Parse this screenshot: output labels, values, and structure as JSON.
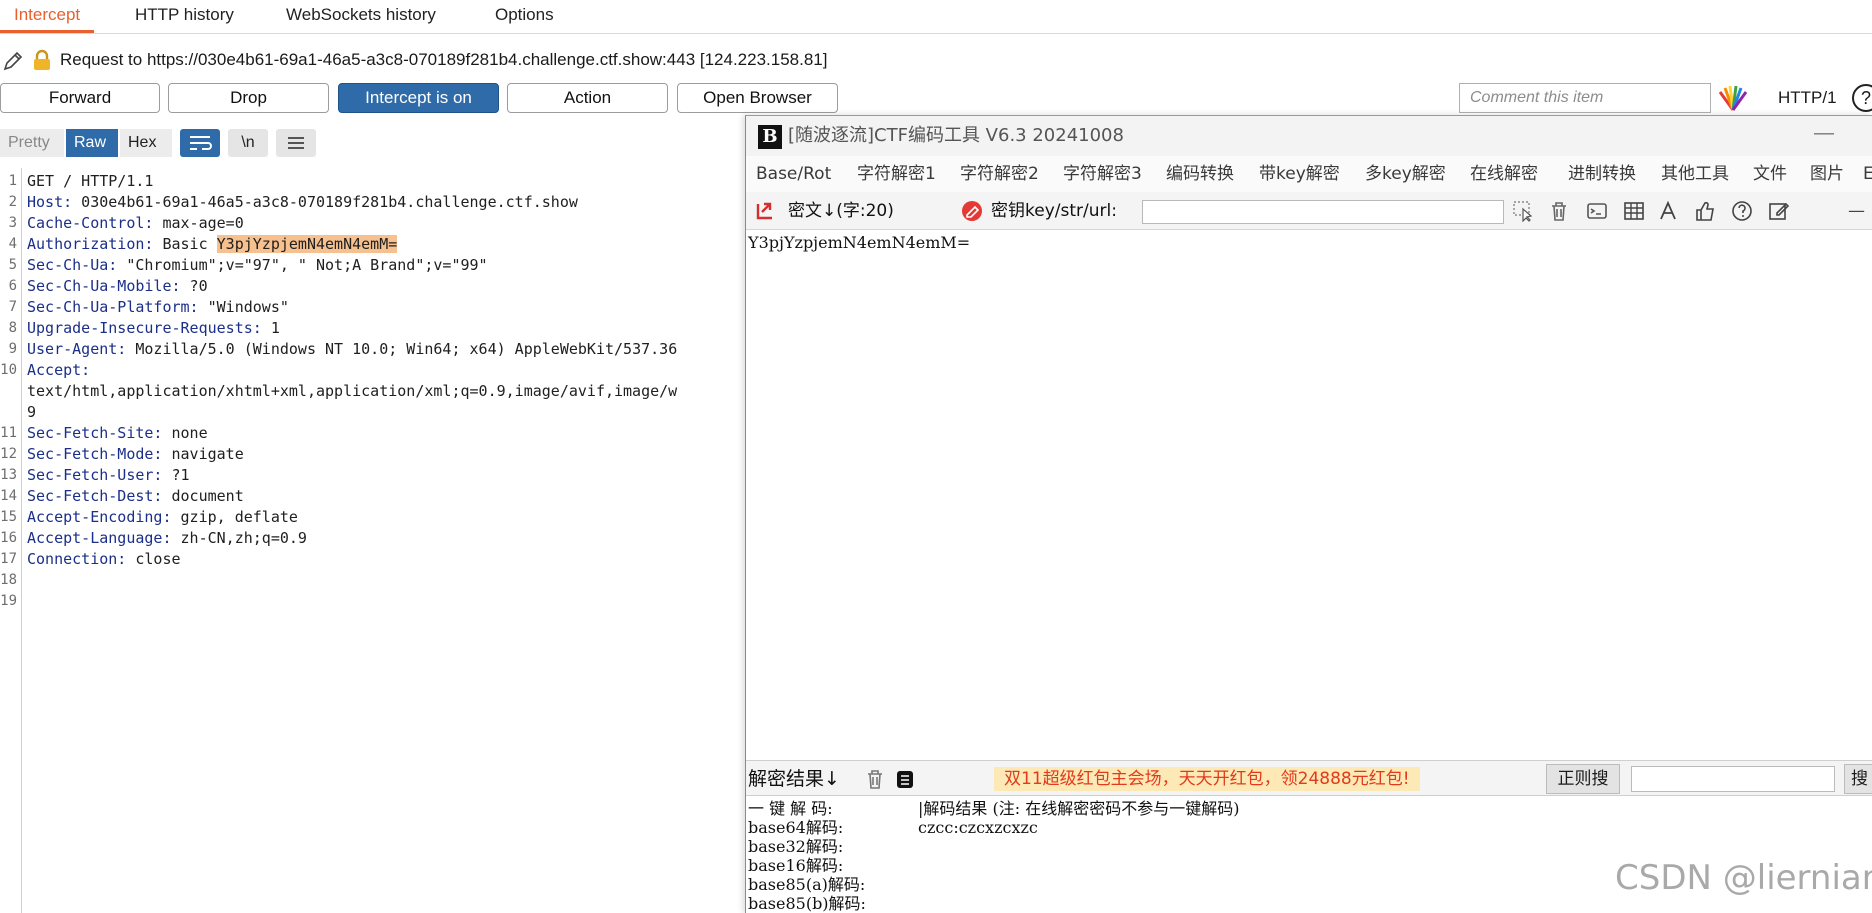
{
  "tabs": [
    "Intercept",
    "HTTP history",
    "WebSockets history",
    "Options"
  ],
  "request_line": "Request to https://030e4b61-69a1-46a5-a3c8-070189f281b4.challenge.ctf.show:443  [124.223.158.81]",
  "toolbar": {
    "forward": "Forward",
    "drop": "Drop",
    "intercept": "Intercept is on",
    "action": "Action",
    "open_browser": "Open Browser",
    "comment_placeholder": "Comment this item",
    "http_version": "HTTP/1",
    "help": "?"
  },
  "view_modes": {
    "pretty": "Pretty",
    "raw": "Raw",
    "hex": "Hex",
    "newline": "\\n"
  },
  "request": {
    "lines": [
      {
        "n": "1",
        "key": "",
        "val": "GET / HTTP/1.1"
      },
      {
        "n": "2",
        "key": "Host:",
        "val": " 030e4b61-69a1-46a5-a3c8-070189f281b4.challenge.ctf.show"
      },
      {
        "n": "3",
        "key": "Cache-Control:",
        "val": " max-age=0"
      },
      {
        "n": "4",
        "key": "Authorization:",
        "val": " Basic "
      },
      {
        "n": "5",
        "key": "Sec-Ch-Ua:",
        "val": " \"Chromium\";v=\"97\", \" Not;A Brand\";v=\"99\""
      },
      {
        "n": "6",
        "key": "Sec-Ch-Ua-Mobile:",
        "val": " ?0"
      },
      {
        "n": "7",
        "key": "Sec-Ch-Ua-Platform:",
        "val": " \"Windows\""
      },
      {
        "n": "8",
        "key": "Upgrade-Insecure-Requests:",
        "val": " 1"
      },
      {
        "n": "9",
        "key": "User-Agent:",
        "val": " Mozilla/5.0 (Windows NT 10.0; Win64; x64) AppleWebKit/537.36"
      },
      {
        "n": "10",
        "key": "Accept:",
        "val": ""
      },
      {
        "n": "",
        "key": "",
        "val": "text/html,application/xhtml+xml,application/xml;q=0.9,image/avif,image/w"
      },
      {
        "n": "",
        "key": "",
        "val": "9"
      },
      {
        "n": "11",
        "key": "Sec-Fetch-Site:",
        "val": " none"
      },
      {
        "n": "12",
        "key": "Sec-Fetch-Mode:",
        "val": " navigate"
      },
      {
        "n": "13",
        "key": "Sec-Fetch-User:",
        "val": " ?1"
      },
      {
        "n": "14",
        "key": "Sec-Fetch-Dest:",
        "val": " document"
      },
      {
        "n": "15",
        "key": "Accept-Encoding:",
        "val": " gzip, deflate"
      },
      {
        "n": "16",
        "key": "Accept-Language:",
        "val": " zh-CN,zh;q=0.9"
      },
      {
        "n": "17",
        "key": "Connection:",
        "val": " close"
      },
      {
        "n": "18",
        "key": "",
        "val": ""
      },
      {
        "n": "19",
        "key": "",
        "val": ""
      }
    ],
    "auth_token": "Y3pjYzpjemN4emN4emM="
  },
  "ctf": {
    "title": "[随波逐流]CTF编码工具 V6.3 20241008",
    "logo": "B",
    "minimize": "—",
    "menu": [
      "Base/Rot",
      "字符解密1",
      "字符解密2",
      "字符解密3",
      "编码转换",
      "带key解密",
      "多key解密",
      "在线解密",
      "进制转换",
      "其他工具",
      "文件",
      "图片",
      "E"
    ],
    "cipher_label": "密文↓(字:20)",
    "key_label": "密钥key/str/url:",
    "cipher_text": "Y3pjYzpjemN4emN4emM=",
    "result_label": "解密结果↓",
    "ad": "双11超级红包主会场，天天开红包，领24888元红包!",
    "regex_search": "正则搜",
    "search": "搜",
    "results": [
      {
        "label": "一 键 解 码:",
        "value": "|解码结果 (注: 在线解密密码不参与一键解码)"
      },
      {
        "label": "base64解码:",
        "value": "czcc:czcxzcxzc"
      },
      {
        "label": "base32解码:",
        "value": ""
      },
      {
        "label": "base16解码:",
        "value": ""
      },
      {
        "label": "base85(a)解码:",
        "value": ""
      },
      {
        "label": "base85(b)解码:",
        "value": ""
      }
    ]
  },
  "watermark": "CSDN @liernian"
}
